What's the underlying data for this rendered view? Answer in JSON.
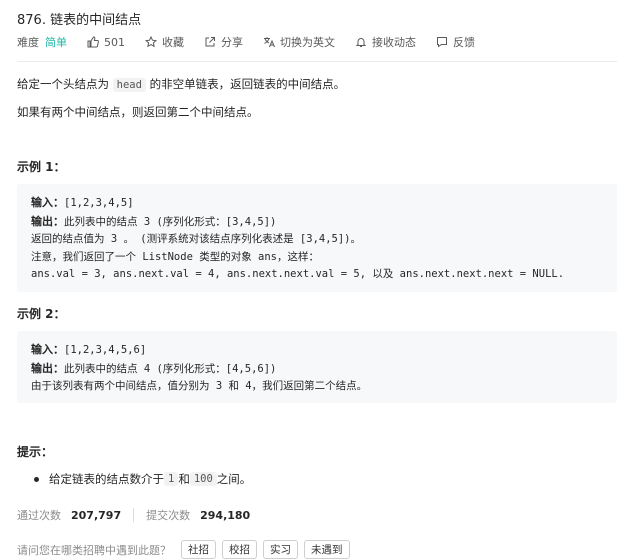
{
  "problem": {
    "title": "876. 链表的中间结点",
    "difficulty_label": "难度",
    "difficulty": "简单",
    "likes": "501",
    "favorite": "收藏",
    "share": "分享",
    "switch_lang": "切换为英文",
    "subscribe": "接收动态",
    "feedback": "反馈"
  },
  "description": {
    "line1_before": "给定一个头结点为 ",
    "line1_code": "head",
    "line1_after": " 的非空单链表，返回链表的中间结点。",
    "line2": "如果有两个中间结点，则返回第二个中间结点。"
  },
  "example1": {
    "heading": "示例 1：",
    "input_label": "输入：",
    "input_value": "[1,2,3,4,5]",
    "output_label": "输出：",
    "output_value": "此列表中的结点 3 (序列化形式：[3,4,5])",
    "line3": "返回的结点值为 3 。 (测评系统对该结点序列化表述是 [3,4,5])。",
    "line4": "注意，我们返回了一个 ListNode 类型的对象 ans，这样：",
    "line5": "ans.val = 3, ans.next.val = 4, ans.next.next.val = 5, 以及 ans.next.next.next = NULL."
  },
  "example2": {
    "heading": "示例 2：",
    "input_label": "输入：",
    "input_value": "[1,2,3,4,5,6]",
    "output_label": "输出：",
    "output_value": "此列表中的结点 4 (序列化形式：[4,5,6])",
    "line3": "由于该列表有两个中间结点，值分别为 3 和 4，我们返回第二个结点。"
  },
  "hints": {
    "heading": "提示：",
    "item_before": "给定链表的结点数介于 ",
    "item_code1": "1",
    "item_mid": " 和 ",
    "item_code2": "100",
    "item_after": " 之间。"
  },
  "stats": {
    "accepted_label": "通过次数",
    "accepted_value": "207,797",
    "submitted_label": "提交次数",
    "submitted_value": "294,180"
  },
  "interview": {
    "question": "请问您在哪类招聘中遇到此题？",
    "tags": [
      "社招",
      "校招",
      "实习",
      "未遇到"
    ]
  },
  "colors": {
    "easy": "#1cb8a8",
    "code_bg": "#f2f2f2",
    "block_bg": "#f7f8fa"
  }
}
